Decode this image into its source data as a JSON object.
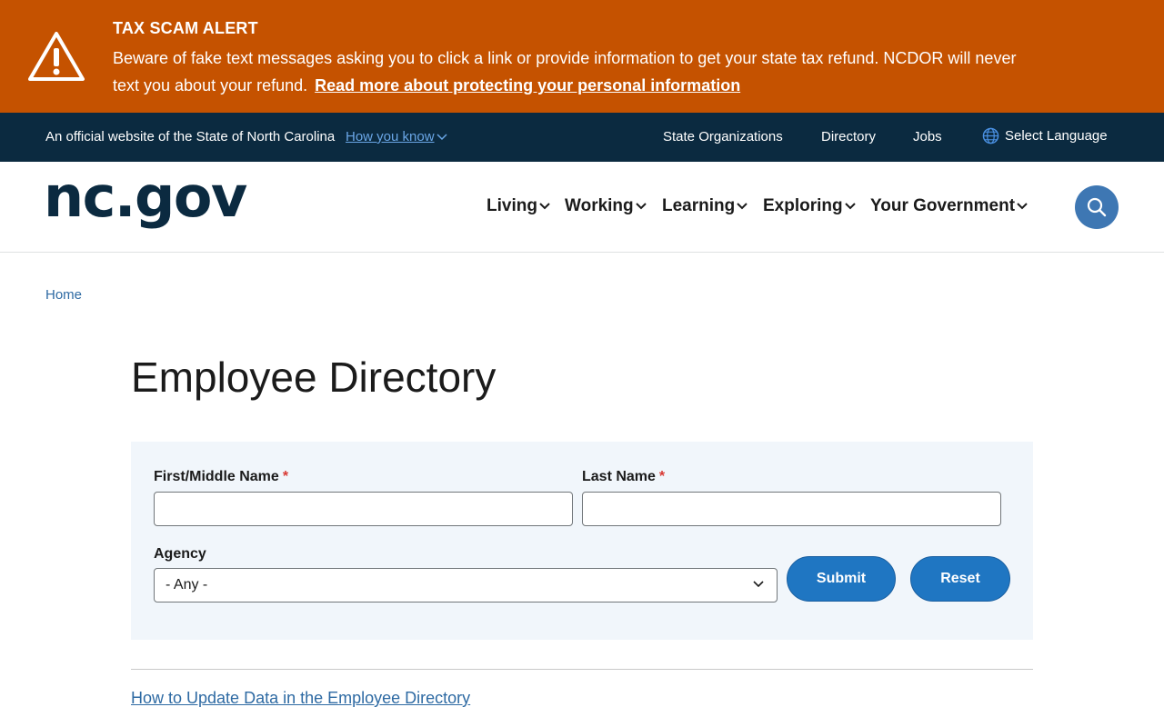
{
  "alert": {
    "title": "TAX SCAM ALERT",
    "body": "Beware of fake text messages asking you to click a link or provide information to get your state tax refund. NCDOR will never text you about your refund.",
    "link": "Read more about protecting your personal information",
    "icon": "warning-icon",
    "color": "#c55200"
  },
  "official_bar": {
    "text": "An official website of the State of North Carolina",
    "how_you_know": "How you know",
    "links": [
      "State Organizations",
      "Directory",
      "Jobs"
    ],
    "language": "Select Language",
    "color": "#0b2a40"
  },
  "header": {
    "logo": "nc.gov",
    "nav": [
      "Living",
      "Working",
      "Learning",
      "Exploring",
      "Your Government"
    ],
    "search_icon": "search-icon"
  },
  "breadcrumb": {
    "home": "Home"
  },
  "page": {
    "title": "Employee Directory"
  },
  "form": {
    "first_name_label": "First/Middle Name",
    "last_name_label": "Last Name",
    "required_mark": "*",
    "first_name_value": "",
    "last_name_value": "",
    "agency_label": "Agency",
    "agency_selected": "- Any -",
    "submit": "Submit",
    "reset": "Reset",
    "button_color": "#1f76c2"
  },
  "footer_link": "How to Update Data in the Employee Directory"
}
